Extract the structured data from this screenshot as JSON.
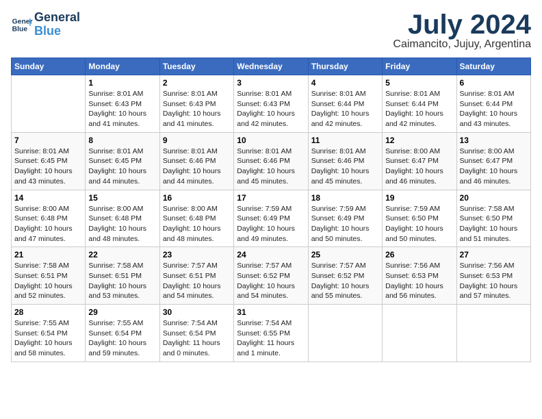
{
  "header": {
    "logo_line1": "General",
    "logo_line2": "Blue",
    "month": "July 2024",
    "location": "Caimancito, Jujuy, Argentina"
  },
  "days_of_week": [
    "Sunday",
    "Monday",
    "Tuesday",
    "Wednesday",
    "Thursday",
    "Friday",
    "Saturday"
  ],
  "weeks": [
    [
      {
        "day": "",
        "info": ""
      },
      {
        "day": "1",
        "info": "Sunrise: 8:01 AM\nSunset: 6:43 PM\nDaylight: 10 hours\nand 41 minutes."
      },
      {
        "day": "2",
        "info": "Sunrise: 8:01 AM\nSunset: 6:43 PM\nDaylight: 10 hours\nand 41 minutes."
      },
      {
        "day": "3",
        "info": "Sunrise: 8:01 AM\nSunset: 6:43 PM\nDaylight: 10 hours\nand 42 minutes."
      },
      {
        "day": "4",
        "info": "Sunrise: 8:01 AM\nSunset: 6:44 PM\nDaylight: 10 hours\nand 42 minutes."
      },
      {
        "day": "5",
        "info": "Sunrise: 8:01 AM\nSunset: 6:44 PM\nDaylight: 10 hours\nand 42 minutes."
      },
      {
        "day": "6",
        "info": "Sunrise: 8:01 AM\nSunset: 6:44 PM\nDaylight: 10 hours\nand 43 minutes."
      }
    ],
    [
      {
        "day": "7",
        "info": "Sunrise: 8:01 AM\nSunset: 6:45 PM\nDaylight: 10 hours\nand 43 minutes."
      },
      {
        "day": "8",
        "info": "Sunrise: 8:01 AM\nSunset: 6:45 PM\nDaylight: 10 hours\nand 44 minutes."
      },
      {
        "day": "9",
        "info": "Sunrise: 8:01 AM\nSunset: 6:46 PM\nDaylight: 10 hours\nand 44 minutes."
      },
      {
        "day": "10",
        "info": "Sunrise: 8:01 AM\nSunset: 6:46 PM\nDaylight: 10 hours\nand 45 minutes."
      },
      {
        "day": "11",
        "info": "Sunrise: 8:01 AM\nSunset: 6:46 PM\nDaylight: 10 hours\nand 45 minutes."
      },
      {
        "day": "12",
        "info": "Sunrise: 8:00 AM\nSunset: 6:47 PM\nDaylight: 10 hours\nand 46 minutes."
      },
      {
        "day": "13",
        "info": "Sunrise: 8:00 AM\nSunset: 6:47 PM\nDaylight: 10 hours\nand 46 minutes."
      }
    ],
    [
      {
        "day": "14",
        "info": "Sunrise: 8:00 AM\nSunset: 6:48 PM\nDaylight: 10 hours\nand 47 minutes."
      },
      {
        "day": "15",
        "info": "Sunrise: 8:00 AM\nSunset: 6:48 PM\nDaylight: 10 hours\nand 48 minutes."
      },
      {
        "day": "16",
        "info": "Sunrise: 8:00 AM\nSunset: 6:48 PM\nDaylight: 10 hours\nand 48 minutes."
      },
      {
        "day": "17",
        "info": "Sunrise: 7:59 AM\nSunset: 6:49 PM\nDaylight: 10 hours\nand 49 minutes."
      },
      {
        "day": "18",
        "info": "Sunrise: 7:59 AM\nSunset: 6:49 PM\nDaylight: 10 hours\nand 50 minutes."
      },
      {
        "day": "19",
        "info": "Sunrise: 7:59 AM\nSunset: 6:50 PM\nDaylight: 10 hours\nand 50 minutes."
      },
      {
        "day": "20",
        "info": "Sunrise: 7:58 AM\nSunset: 6:50 PM\nDaylight: 10 hours\nand 51 minutes."
      }
    ],
    [
      {
        "day": "21",
        "info": "Sunrise: 7:58 AM\nSunset: 6:51 PM\nDaylight: 10 hours\nand 52 minutes."
      },
      {
        "day": "22",
        "info": "Sunrise: 7:58 AM\nSunset: 6:51 PM\nDaylight: 10 hours\nand 53 minutes."
      },
      {
        "day": "23",
        "info": "Sunrise: 7:57 AM\nSunset: 6:51 PM\nDaylight: 10 hours\nand 54 minutes."
      },
      {
        "day": "24",
        "info": "Sunrise: 7:57 AM\nSunset: 6:52 PM\nDaylight: 10 hours\nand 54 minutes."
      },
      {
        "day": "25",
        "info": "Sunrise: 7:57 AM\nSunset: 6:52 PM\nDaylight: 10 hours\nand 55 minutes."
      },
      {
        "day": "26",
        "info": "Sunrise: 7:56 AM\nSunset: 6:53 PM\nDaylight: 10 hours\nand 56 minutes."
      },
      {
        "day": "27",
        "info": "Sunrise: 7:56 AM\nSunset: 6:53 PM\nDaylight: 10 hours\nand 57 minutes."
      }
    ],
    [
      {
        "day": "28",
        "info": "Sunrise: 7:55 AM\nSunset: 6:54 PM\nDaylight: 10 hours\nand 58 minutes."
      },
      {
        "day": "29",
        "info": "Sunrise: 7:55 AM\nSunset: 6:54 PM\nDaylight: 10 hours\nand 59 minutes."
      },
      {
        "day": "30",
        "info": "Sunrise: 7:54 AM\nSunset: 6:54 PM\nDaylight: 11 hours\nand 0 minutes."
      },
      {
        "day": "31",
        "info": "Sunrise: 7:54 AM\nSunset: 6:55 PM\nDaylight: 11 hours\nand 1 minute."
      },
      {
        "day": "",
        "info": ""
      },
      {
        "day": "",
        "info": ""
      },
      {
        "day": "",
        "info": ""
      }
    ]
  ]
}
